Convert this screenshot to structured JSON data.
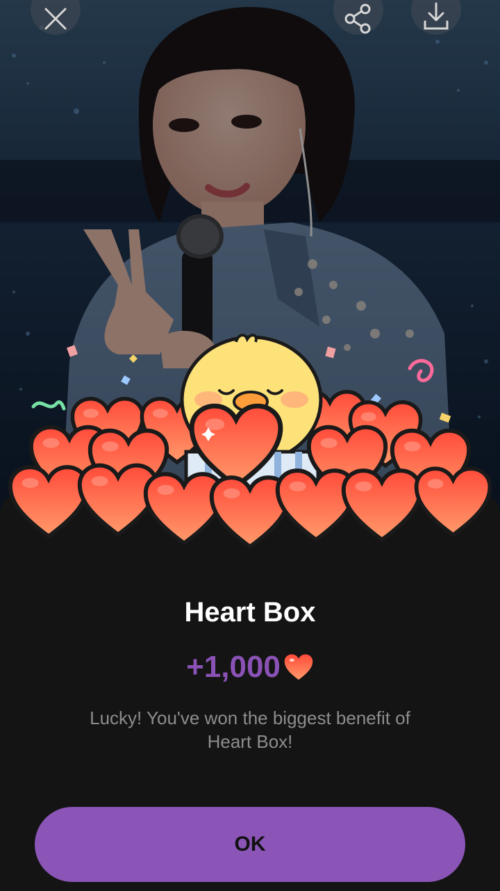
{
  "toolbar": {
    "close_icon": "close-icon",
    "share_icon": "share-icon",
    "download_icon": "download-icon"
  },
  "dialog": {
    "title": "Heart Box",
    "reward_amount": "+1,000",
    "reward_icon": "heart-icon",
    "message": "Lucky! You've won the biggest benefit of Heart Box!",
    "ok_label": "OK"
  },
  "colors": {
    "accent": "#8a55b7",
    "reward_text": "#8a52b5",
    "sheet_bg": "#141414",
    "heart": "#ff5a3c"
  }
}
